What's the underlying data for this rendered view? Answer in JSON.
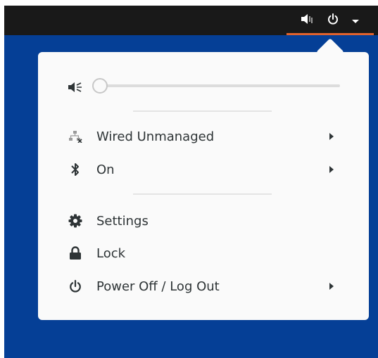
{
  "topbar": {
    "status_icons": [
      "speaker-icon",
      "power-icon",
      "dropdown-arrow-icon"
    ],
    "accent_color": "#e0622d"
  },
  "menu": {
    "volume": {
      "icon": "speaker-muted-icon",
      "level": 0
    },
    "items": [
      {
        "icon": "network-wired-icon",
        "label": "Wired Unmanaged",
        "has_submenu": true
      },
      {
        "icon": "bluetooth-icon",
        "label": "On",
        "has_submenu": true
      },
      {
        "icon": "gear-icon",
        "label": "Settings",
        "has_submenu": false
      },
      {
        "icon": "lock-icon",
        "label": "Lock",
        "has_submenu": false
      },
      {
        "icon": "power-icon",
        "label": "Power Off / Log Out",
        "has_submenu": true
      }
    ]
  },
  "colors": {
    "desktop_bg": "#053f96",
    "topbar_bg": "#191919",
    "menu_bg": "#fafafa",
    "text": "#2e3436"
  }
}
